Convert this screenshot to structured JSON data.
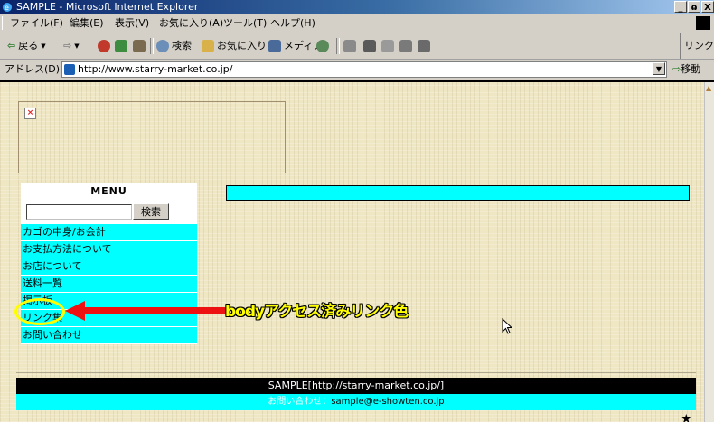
{
  "window": {
    "title": "SAMPLE - Microsoft Internet Explorer",
    "minimize": "_",
    "restore": "ɷ",
    "close": "X"
  },
  "menubar": {
    "items": [
      "ファイル(F)",
      "編集(E)",
      "表示(V)",
      "お気に入り(A)",
      "ツール(T)",
      "ヘルプ(H)"
    ]
  },
  "toolbar": {
    "back": "戻る",
    "search": "検索",
    "favorites": "お気に入り",
    "media": "メディア",
    "links": "リンク"
  },
  "addressbar": {
    "label": "アドレス(D)",
    "url": "http://www.starry-market.co.jp/",
    "go": "移動"
  },
  "sidebar": {
    "menu_title": "MENU",
    "search_button": "検索",
    "search_value": "",
    "items": [
      "カゴの中身/お会計",
      "お支払方法について",
      "お店について",
      "送料一覧",
      "掲示板",
      "リンク集",
      "お問い合わせ"
    ]
  },
  "annotation": {
    "text": "bodyアクセス済みリンク色",
    "color": "#ffff00",
    "arrow_color": "#ee1111"
  },
  "footer": {
    "copyright": "SAMPLE[http://starry-market.co.jp/]",
    "contact_label": "お問い合わせ：",
    "contact_email": "sample@e-showten.co.jp"
  },
  "colors": {
    "nav_bg": "#00ffff",
    "page_bg": "#efe6c3",
    "footer_top": "#000000"
  },
  "icons": {
    "broken_image": "broken-image-icon",
    "cursor": "mouse-pointer-icon",
    "footer_mark": "star-icon"
  }
}
